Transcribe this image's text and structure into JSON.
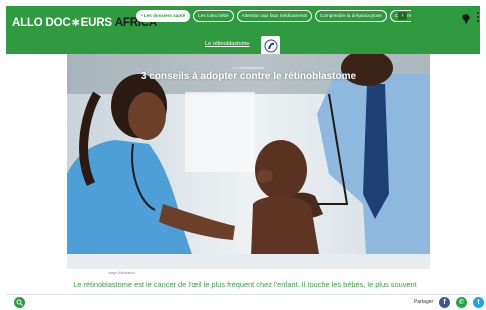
{
  "header": {
    "logo_main": "ALLO DOC",
    "logo_star": "✱",
    "logo_mid": "EURS",
    "logo_africa": "AFRICA",
    "nav_pills": [
      "• Les dossiers santé",
      "Les tuteu bébé",
      "Attention aux faux médicaments",
      "Comprendre la drépanocytose",
      "Comprendre le"
    ],
    "next_icon": "›"
  },
  "section": {
    "label": "Le rétinoblastome"
  },
  "hero": {
    "kicker": "Le rétinoblastome",
    "title": "3 conseils à adopter contre le rétinoblastome",
    "caption": "Image d'illustration"
  },
  "article": {
    "lead": "Le rétinoblastome est le cancer de l'œil le plus fréquent chez l'enfant. Il touche les bébés, le plus souvent"
  },
  "footer": {
    "share_label": "Partager",
    "social": [
      {
        "name": "facebook",
        "glyph": "f",
        "color": "#3b5998"
      },
      {
        "name": "whatsapp",
        "glyph": "✆",
        "color": "#25a244"
      },
      {
        "name": "twitter",
        "glyph": "t",
        "color": "#1da1f2"
      }
    ]
  },
  "colors": {
    "brand_green": "#2f9a3f",
    "lead_green": "#3a9d4a"
  }
}
